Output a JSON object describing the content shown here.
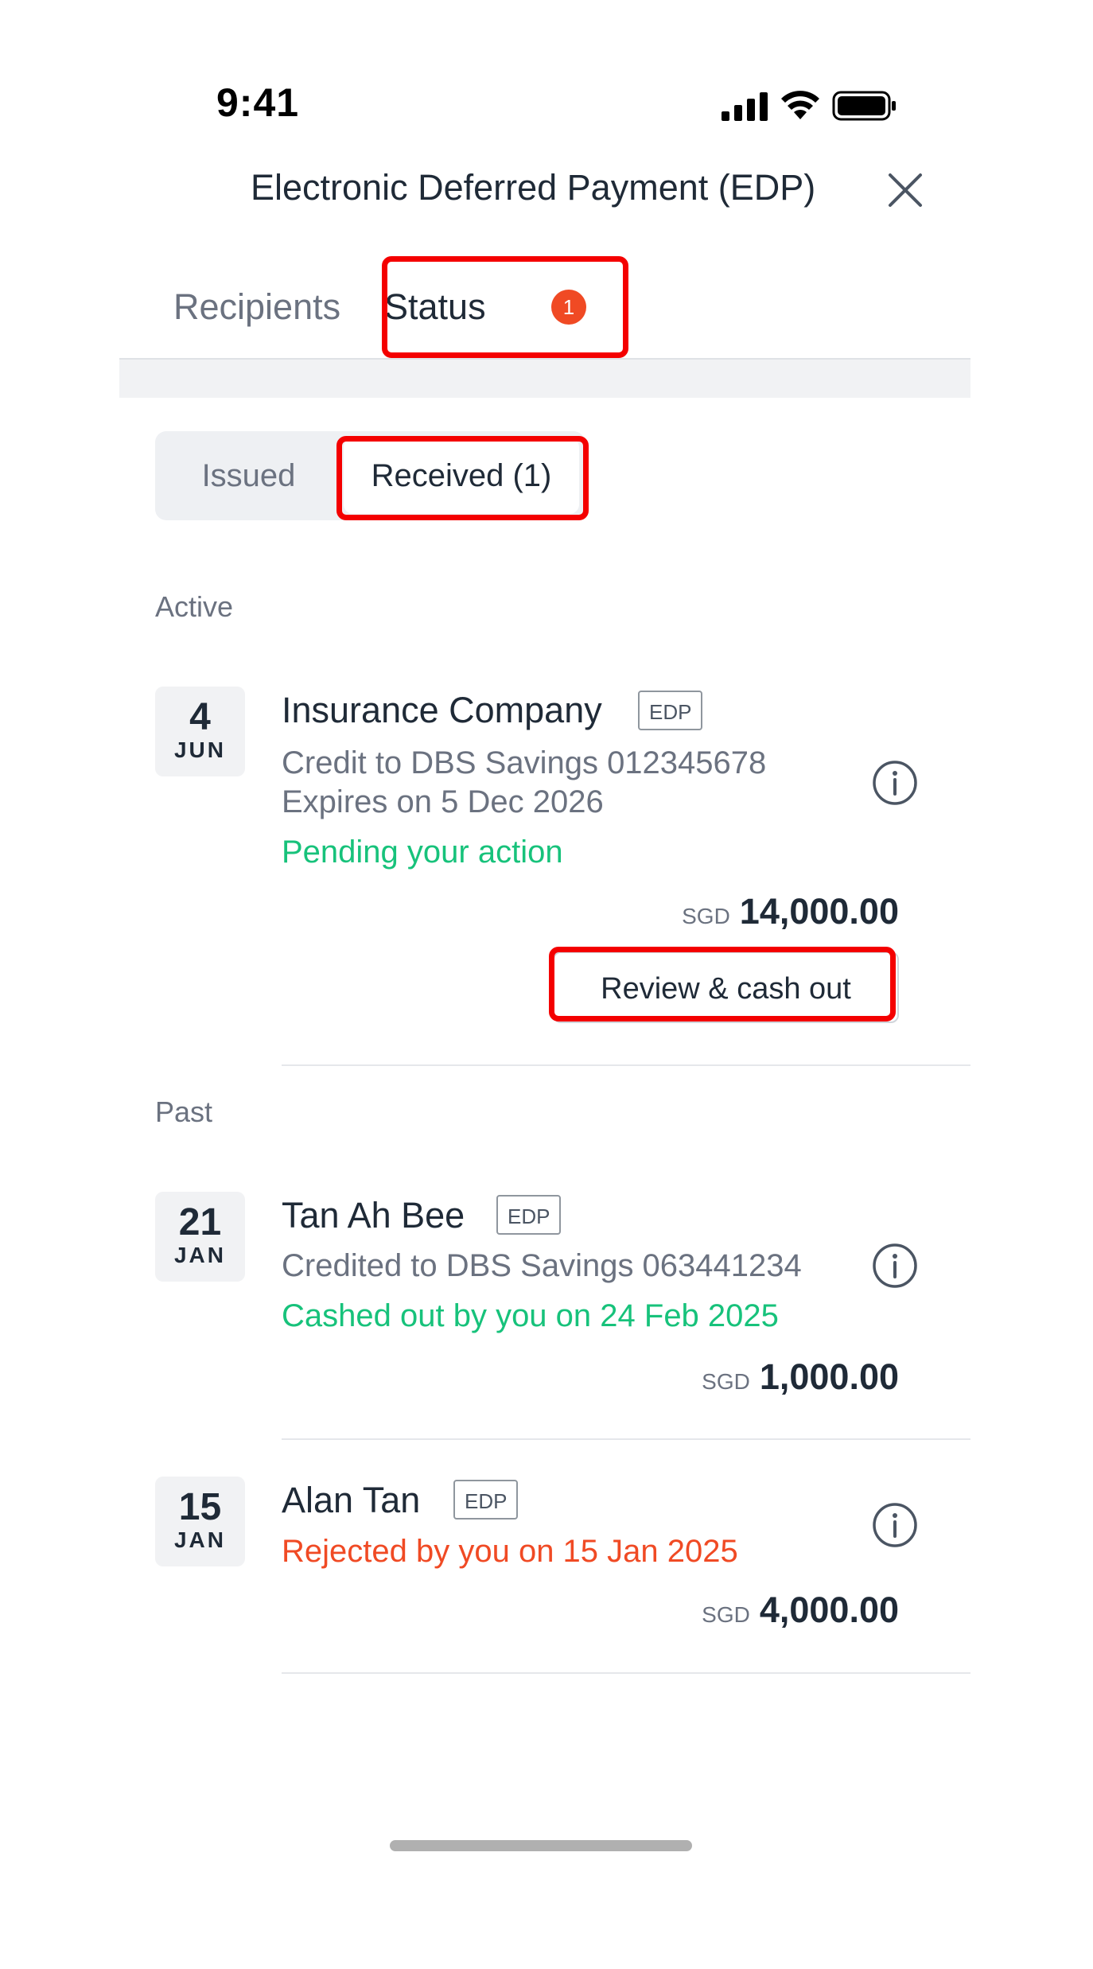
{
  "status_bar": {
    "time": "9:41"
  },
  "header": {
    "title": "Electronic Deferred Payment (EDP)",
    "close_icon": "close-icon"
  },
  "tabs": {
    "recipients": "Recipients",
    "status": "Status",
    "status_badge": "1"
  },
  "segment": {
    "issued": "Issued",
    "received": "Received (1)"
  },
  "sections": {
    "active": "Active",
    "past": "Past"
  },
  "active_items": [
    {
      "day": "4",
      "month": "JUN",
      "name": "Insurance Company",
      "tag": "EDP",
      "line1": "Credit to DBS Savings 012345678",
      "line2": "Expires on 5 Dec 2026",
      "status": "Pending your action",
      "currency": "SGD",
      "amount": "14,000.00",
      "action": "Review & cash out"
    }
  ],
  "past_items": [
    {
      "day": "21",
      "month": "JAN",
      "name": "Tan Ah Bee",
      "tag": "EDP",
      "line1": "Credited to DBS Savings 063441234",
      "status": "Cashed out by you on 24 Feb 2025",
      "currency": "SGD",
      "amount": "1,000.00"
    },
    {
      "day": "15",
      "month": "JAN",
      "name": "Alan Tan",
      "tag": "EDP",
      "status": "Rejected by you on 15 Jan 2025",
      "currency": "SGD",
      "amount": "4,000.00"
    }
  ],
  "colors": {
    "highlight": "#f40000",
    "badge": "#f04a24",
    "success": "#17c27b",
    "rejected": "#f04a24",
    "text": "#1f2a37",
    "muted": "#6b7280"
  }
}
